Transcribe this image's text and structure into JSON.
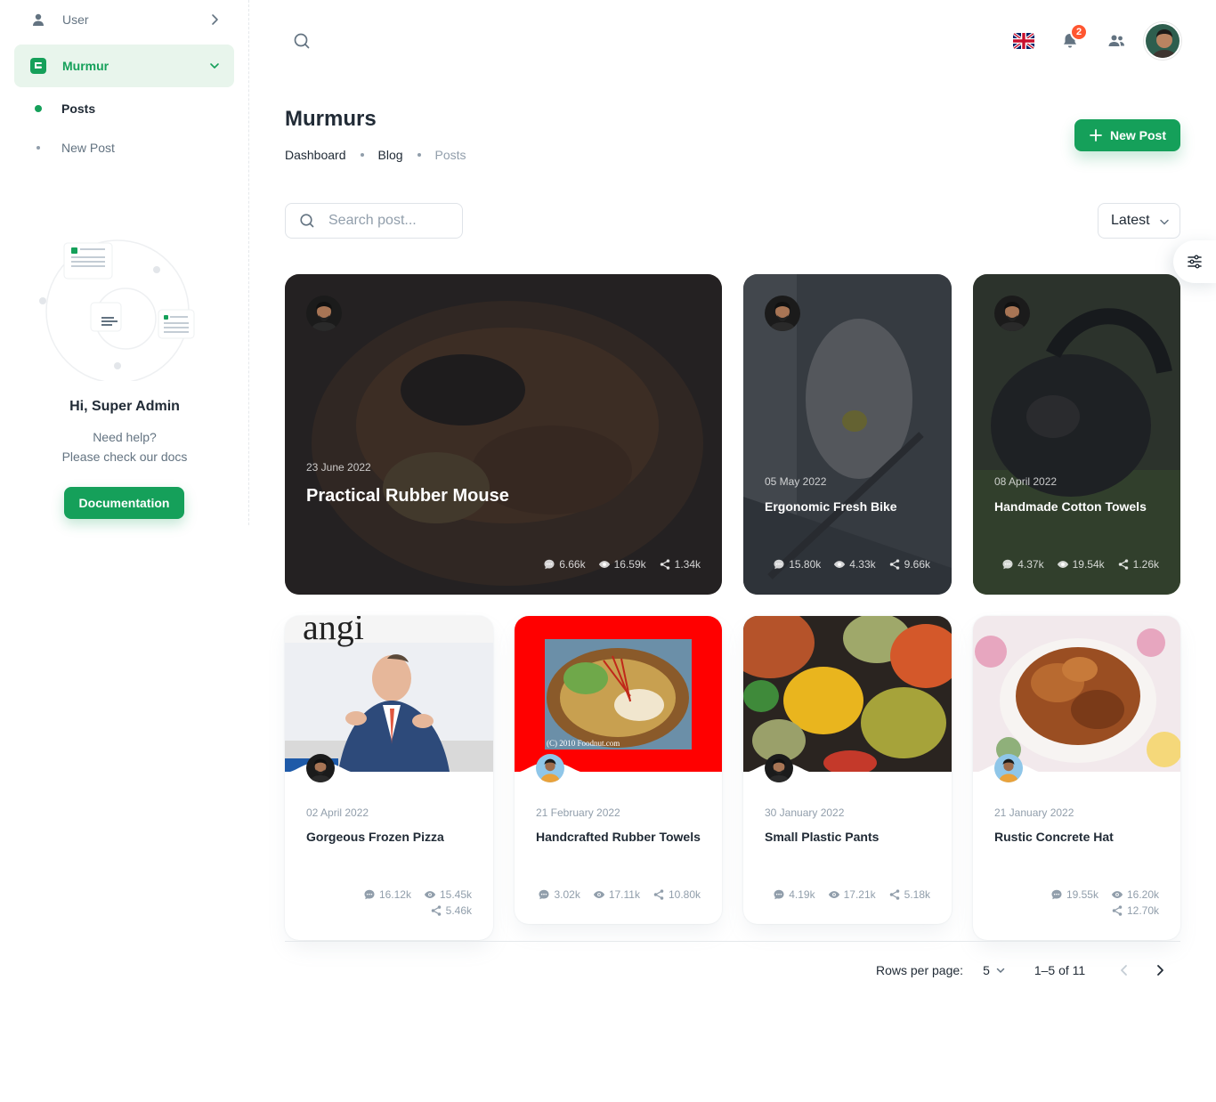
{
  "sidebar": {
    "user_label": "User",
    "murmur_label": "Murmur",
    "posts_label": "Posts",
    "new_post_label": "New Post",
    "greeting": "Hi, Super Admin",
    "help_line1": "Need help?",
    "help_line2": "Please check our docs",
    "doc_button": "Documentation"
  },
  "topbar": {
    "notification_count": "2",
    "language": "English (UK flag)"
  },
  "header": {
    "title": "Murmurs",
    "breadcrumb": [
      "Dashboard",
      "Blog",
      "Posts"
    ],
    "new_post_button": "New Post"
  },
  "filters": {
    "search_placeholder": "Search post...",
    "sort_value": "Latest"
  },
  "posts": [
    {
      "date": "23 June 2022",
      "title": "Practical Rubber Mouse",
      "comments": "6.66k",
      "views": "16.59k",
      "shares": "1.34k"
    },
    {
      "date": "05 May 2022",
      "title": "Ergonomic Fresh Bike",
      "comments": "15.80k",
      "views": "4.33k",
      "shares": "9.66k"
    },
    {
      "date": "08 April 2022",
      "title": "Handmade Cotton Towels",
      "comments": "4.37k",
      "views": "19.54k",
      "shares": "1.26k"
    },
    {
      "date": "02 April 2022",
      "title": "Gorgeous Frozen Pizza",
      "comments": "16.12k",
      "views": "15.45k",
      "shares": "5.46k"
    },
    {
      "date": "21 February 2022",
      "title": "Handcrafted Rubber Towels",
      "comments": "3.02k",
      "views": "17.11k",
      "shares": "10.80k"
    },
    {
      "date": "30 January 2022",
      "title": "Small Plastic Pants",
      "comments": "4.19k",
      "views": "17.21k",
      "shares": "5.18k"
    },
    {
      "date": "21 January 2022",
      "title": "Rustic Concrete Hat",
      "comments": "19.55k",
      "views": "16.20k",
      "shares": "12.70k"
    }
  ],
  "pagination": {
    "rows_per_page_label": "Rows per page:",
    "rows_per_page": "5",
    "range": "1–5 of 11"
  },
  "colors": {
    "primary": "#15A05A",
    "badge": "#FF5630",
    "text": "#212B36",
    "muted": "#919EAB"
  }
}
